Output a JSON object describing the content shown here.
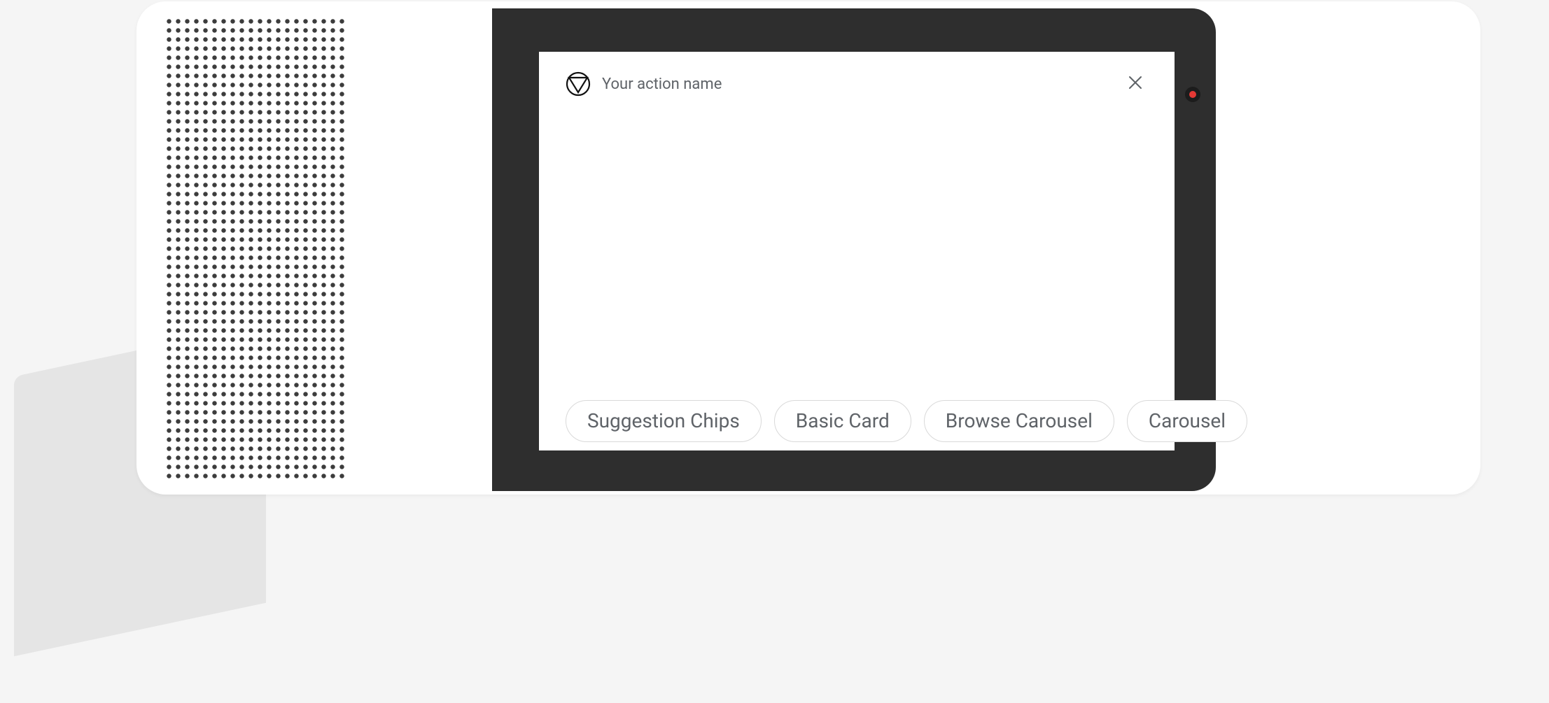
{
  "header": {
    "action_name": "Your action name"
  },
  "chips": [
    {
      "label": "Suggestion Chips"
    },
    {
      "label": "Basic Card"
    },
    {
      "label": "Browse Carousel"
    },
    {
      "label": "Carousel"
    }
  ]
}
